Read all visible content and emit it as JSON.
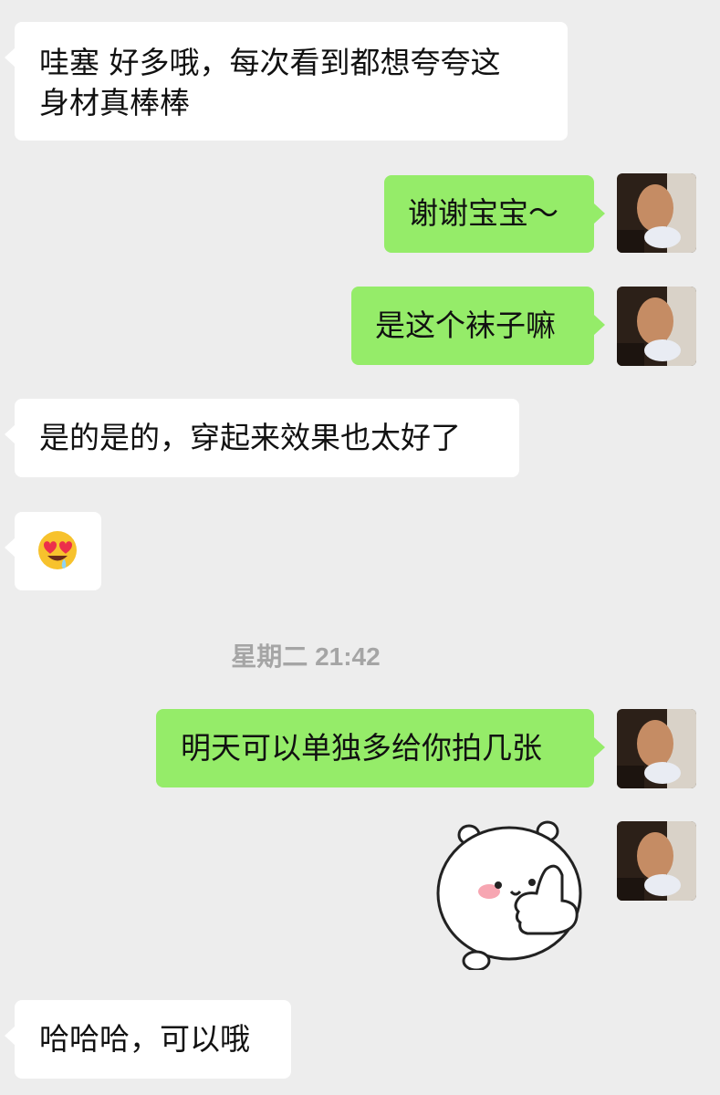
{
  "messages": [
    {
      "side": "left",
      "text_lines": [
        "哇塞  好多哦，每次看到都想夸夸这",
        "身材真棒棒"
      ]
    },
    {
      "side": "right",
      "text": "谢谢宝宝～"
    },
    {
      "side": "right",
      "text": "是这个袜子嘛"
    },
    {
      "side": "left",
      "text": "是的是的，穿起来效果也太好了"
    },
    {
      "side": "left",
      "emoji": "🤤",
      "emoji_name": "heart-eyes-drooling-emoji"
    },
    {
      "type": "timestamp",
      "text": "星期二 21:42"
    },
    {
      "side": "right",
      "text": "明天可以单独多给你拍几张"
    },
    {
      "side": "right",
      "type": "sticker",
      "sticker_name": "thumbs-up-bear-sticker"
    },
    {
      "side": "left",
      "text": "哈哈哈，可以哦"
    }
  ],
  "colors": {
    "background": "#ededed",
    "incoming_bubble": "#ffffff",
    "outgoing_bubble": "#95ec69",
    "timestamp_text": "#a5a5a5"
  }
}
